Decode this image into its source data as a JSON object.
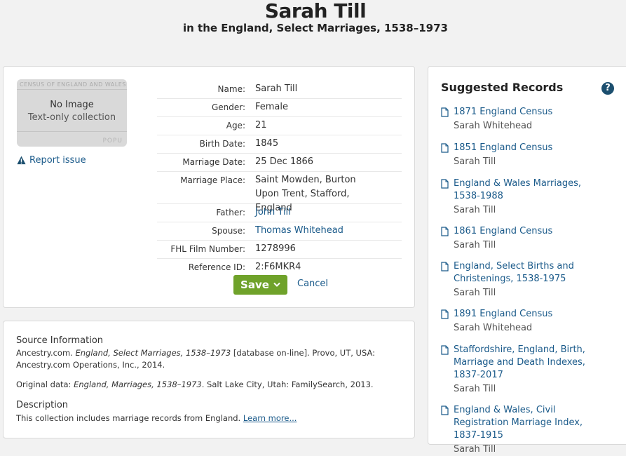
{
  "header": {
    "title": "Sarah Till",
    "subtitle": "in the England, Select Marriages, 1538–1973"
  },
  "image": {
    "no_image": "No Image",
    "text_only": "Text-only collection"
  },
  "report_issue": "Report issue",
  "fields": [
    {
      "label": "Name:",
      "value": "Sarah Till",
      "link": false
    },
    {
      "label": "Gender:",
      "value": "Female",
      "link": false
    },
    {
      "label": "Age:",
      "value": "21",
      "link": false
    },
    {
      "label": "Birth Date:",
      "value": "1845",
      "link": false
    },
    {
      "label": "Marriage Date:",
      "value": "25 Dec 1866",
      "link": false
    },
    {
      "label": "Marriage Place:",
      "value": "Saint Mowden, Burton Upon Trent, Stafford, England",
      "link": false
    },
    {
      "label": "Father:",
      "value": "John Till",
      "link": true
    },
    {
      "label": "Spouse:",
      "value": "Thomas Whitehead",
      "link": true
    },
    {
      "label": "FHL Film Number:",
      "value": "1278996",
      "link": false
    },
    {
      "label": "Reference ID:",
      "value": "2:F6MKR4",
      "link": false
    }
  ],
  "actions": {
    "save": "Save",
    "cancel": "Cancel"
  },
  "source": {
    "heading": "Source Information",
    "citation_prefix": "Ancestry.com. ",
    "citation_title": "England, Select Marriages, 1538–1973",
    "citation_suffix": " [database on-line]. Provo, UT, USA: Ancestry.com Operations, Inc., 2014.",
    "original_prefix": "Original data: ",
    "original_title": "England, Marriages, 1538–1973",
    "original_suffix": ". Salt Lake City, Utah: FamilySearch, 2013.",
    "description_heading": "Description",
    "description_text": "This collection includes marriage records from England. ",
    "learn_more": "Learn more..."
  },
  "suggested": {
    "title": "Suggested Records",
    "help": "?",
    "items": [
      {
        "name": "1871 England Census",
        "person": "Sarah Whitehead"
      },
      {
        "name": "1851 England Census",
        "person": "Sarah Till"
      },
      {
        "name": "England & Wales Marriages, 1538-1988",
        "person": "Sarah Till"
      },
      {
        "name": "1861 England Census",
        "person": "Sarah Till"
      },
      {
        "name": "England, Select Births and Christenings, 1538-1975",
        "person": "Sarah Till"
      },
      {
        "name": "1891 England Census",
        "person": "Sarah Whitehead"
      },
      {
        "name": "Staffordshire, England, Birth, Marriage and Death Indexes, 1837-2017",
        "person": "Sarah Till"
      },
      {
        "name": "England & Wales, Civil Registration Marriage Index, 1837-1915",
        "person": "Sarah Till"
      }
    ]
  },
  "colors": {
    "link": "#1a5a8a",
    "save_button": "#6fa22a",
    "help_icon": "#1c4f6f",
    "background": "#f2f2f2"
  },
  "icons": [
    "warning-icon",
    "chevron-down-icon",
    "document-icon",
    "help-icon"
  ]
}
